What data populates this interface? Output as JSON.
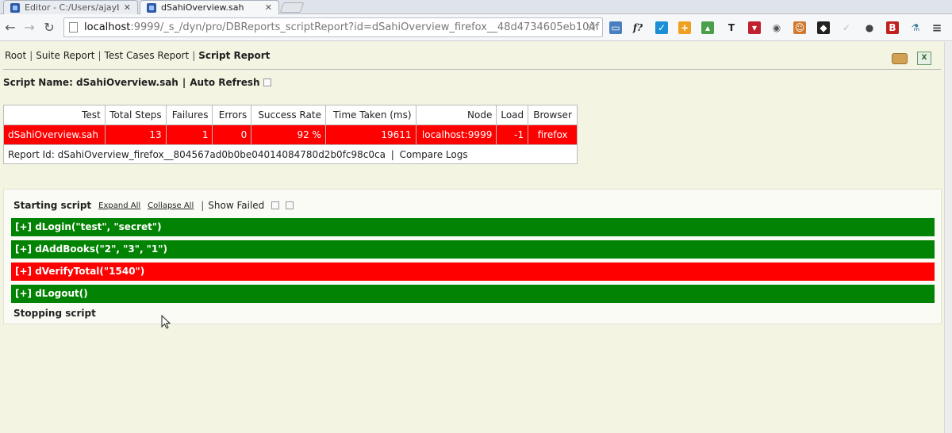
{
  "browser": {
    "tabs": [
      {
        "title": "Editor - C:/Users/ajayb/sa",
        "active": false
      },
      {
        "title": "dSahiOverview.sah",
        "active": true
      }
    ],
    "url_host": "localhost",
    "url_path": ":9999/_s_/dyn/pro/DBReports_scriptReport?id=dSahiOverview_firefox__48d4734605eb104f"
  },
  "breadcrumb": {
    "root": "Root",
    "suite": "Suite Report",
    "testcases": "Test Cases Report",
    "current": "Script Report"
  },
  "script_header": {
    "label": "Script Name: dSahiOverview.sah",
    "sep": "|",
    "auto_refresh": "Auto Refresh"
  },
  "summary": {
    "headers": [
      "Test",
      "Total Steps",
      "Failures",
      "Errors",
      "Success Rate",
      "Time Taken (ms)",
      "Node",
      "Load",
      "Browser"
    ],
    "row": {
      "test": "dSahiOverview.sah",
      "total_steps": "13",
      "failures": "1",
      "errors": "0",
      "success_rate": "92 %",
      "time_taken": "19611",
      "node": "localhost:9999",
      "load": "-1",
      "browser": "firefox"
    },
    "report_id": "Report Id: dSahiOverview_firefox__804567ad0b0be04014084780d2b0fc98c0ca",
    "compare_logs": "Compare Logs"
  },
  "steps_panel": {
    "starting": "Starting script",
    "expand_all": "Expand All",
    "collapse_all": "Collapse All",
    "show_failed": "Show Failed",
    "steps": [
      {
        "label": "[+] dLogin(\"test\", \"secret\")",
        "status": "pass"
      },
      {
        "label": "[+] dAddBooks(\"2\", \"3\", \"1\")",
        "status": "pass"
      },
      {
        "label": "[+] dVerifyTotal(\"1540\")",
        "status": "fail"
      },
      {
        "label": "[+] dLogout()",
        "status": "pass"
      }
    ],
    "stopping": "Stopping script"
  },
  "colors": {
    "pass": "#038303",
    "fail": "#ff0000",
    "page_bg": "#f4f4e2"
  }
}
